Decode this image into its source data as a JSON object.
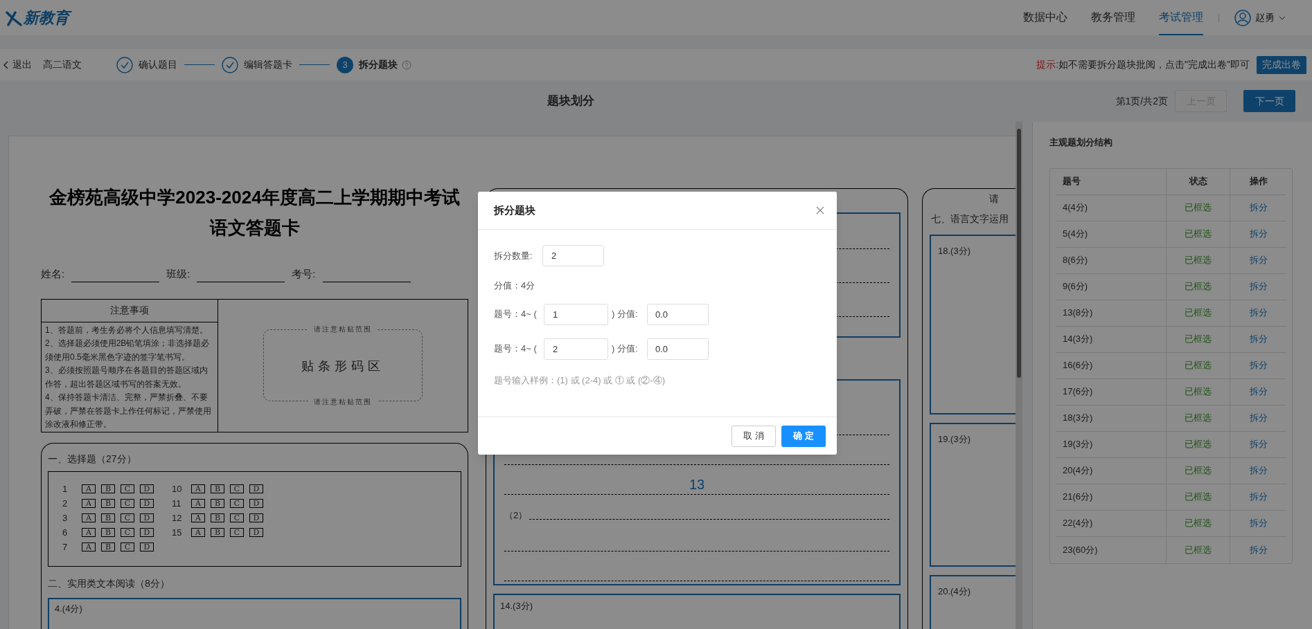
{
  "header": {
    "logo": "新教育",
    "nav": [
      {
        "label": "数据中心",
        "selected": false
      },
      {
        "label": "教务管理",
        "selected": false
      },
      {
        "label": "考试管理",
        "selected": true
      }
    ],
    "user": "赵勇"
  },
  "subbar": {
    "back": "退出",
    "subject": "高二语文",
    "steps": [
      {
        "label": "确认题目",
        "completed": true,
        "selected": false
      },
      {
        "label": "编辑答题卡",
        "completed": true,
        "selected": false
      },
      {
        "label": "拆分题块",
        "completed": false,
        "selected": true,
        "number": "3"
      }
    ],
    "tip_label": "提示:",
    "tip": "如不需要拆分题块批阅，点击\"完成出卷\"即可",
    "finish_button": "完成出卷"
  },
  "title_bar": {
    "title": "题块划分",
    "page_info": "第1页/共2页",
    "prev": {
      "label": "上一页",
      "disabled": true
    },
    "next": {
      "label": "下一页",
      "disabled": false
    }
  },
  "answer_card": {
    "title_lines": [
      "金榜苑高级中学2023-2024年度高二上学期期中考试",
      "语文答题卡"
    ],
    "fields": [
      "姓名:",
      "班级:",
      "考号:"
    ],
    "notice": {
      "heading": "注意事项",
      "items": [
        "1、答题前，考生务必将个人信息填写清楚。",
        "2、选择题必须使用2B铅笔填涂；非选择题必须使用0.5毫米黑色字迹的签字笔书写。",
        "3、必须按照题号顺序在各题目的答题区域内作答，超出答题区域书写的答案无效。",
        "4、保持答题卡清洁、完整，严禁折叠、不要弄破，严禁在答题卡上作任何标记，严禁使用涂改液和修正带。"
      ]
    },
    "barcode": {
      "top": "请注意粘贴范围",
      "label": "贴条形码区",
      "bottom": "请注意粘贴范围"
    },
    "choice_section": {
      "title": "一、选择题（27分）",
      "columns": [
        [
          {
            "number": "1",
            "options": [
              "A",
              "B",
              "C",
              "D"
            ]
          },
          {
            "number": "2",
            "options": [
              "A",
              "B",
              "C",
              "D"
            ]
          },
          {
            "number": "3",
            "options": [
              "A",
              "B",
              "C",
              "D"
            ]
          },
          {
            "number": "6",
            "options": [
              "A",
              "B",
              "C",
              "D"
            ]
          },
          {
            "number": "7",
            "options": [
              "A",
              "B",
              "C",
              "D"
            ]
          }
        ],
        [
          {
            "number": "10",
            "options": [
              "A",
              "B",
              "C",
              "D"
            ]
          },
          {
            "number": "11",
            "options": [
              "A",
              "B",
              "C",
              "D"
            ]
          },
          {
            "number": "12",
            "options": [
              "A",
              "B",
              "C",
              "D"
            ]
          },
          {
            "number": "15",
            "options": [
              "A",
              "B",
              "C",
              "D"
            ]
          }
        ]
      ]
    },
    "reading_section": {
      "title": "二、实用类文本阅读（8分）",
      "block": "4.(4分)"
    },
    "column_2": {
      "block_mark": "13",
      "sub_label": "（2）",
      "next_block": "14.(3分)"
    },
    "column_3": {
      "note": "请",
      "heading": "七、语言文字运用",
      "blocks": [
        "18.(3分)",
        "19.(3分)",
        "20.(4分)"
      ]
    }
  },
  "structure_panel": {
    "title": "主观题划分结构",
    "columns": [
      "题号",
      "状态",
      "操作"
    ],
    "rows": [
      {
        "question": "4(4分)",
        "status": "已框选",
        "action": "拆分"
      },
      {
        "question": "5(4分)",
        "status": "已框选",
        "action": "拆分"
      },
      {
        "question": "8(6分)",
        "status": "已框选",
        "action": "拆分"
      },
      {
        "question": "9(6分)",
        "status": "已框选",
        "action": "拆分"
      },
      {
        "question": "13(8分)",
        "status": "已框选",
        "action": "拆分"
      },
      {
        "question": "14(3分)",
        "status": "已框选",
        "action": "拆分"
      },
      {
        "question": "16(6分)",
        "status": "已框选",
        "action": "拆分"
      },
      {
        "question": "17(6分)",
        "status": "已框选",
        "action": "拆分"
      },
      {
        "question": "18(3分)",
        "status": "已框选",
        "action": "拆分"
      },
      {
        "question": "19(3分)",
        "status": "已框选",
        "action": "拆分"
      },
      {
        "question": "20(4分)",
        "status": "已框选",
        "action": "拆分"
      },
      {
        "question": "21(6分)",
        "status": "已框选",
        "action": "拆分"
      },
      {
        "question": "22(4分)",
        "status": "已框选",
        "action": "拆分"
      },
      {
        "question": "23(60分)",
        "status": "已框选",
        "action": "拆分"
      }
    ]
  },
  "dialog": {
    "title": "拆分题块",
    "count_label": "拆分数量:",
    "count_value": "2",
    "score_text": "分值：4分",
    "splits": [
      {
        "prefix": "题号：4~ (",
        "number": "1",
        "suffix": ") 分值:",
        "score": "0.0"
      },
      {
        "prefix": "题号：4~ (",
        "number": "2",
        "suffix": ") 分值:",
        "score": "0.0"
      }
    ],
    "hint": "题号输入样例：(1) 或 (2-4) 或 ① 或 (②-④)",
    "cancel": "取 消",
    "confirm": "确 定"
  }
}
